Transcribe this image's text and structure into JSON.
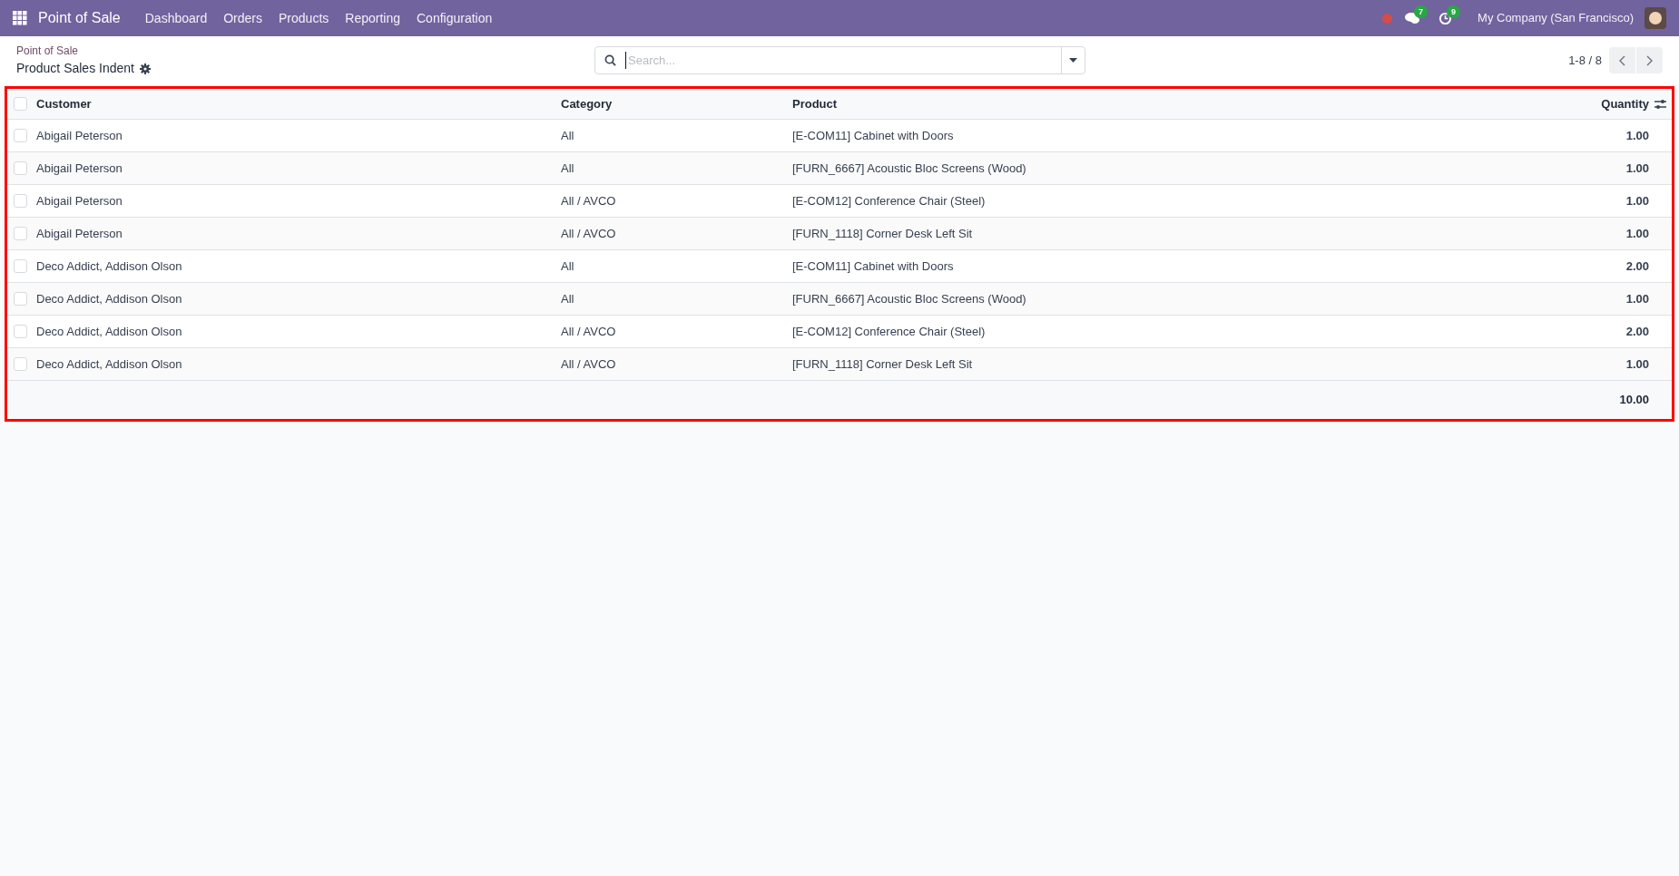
{
  "navbar": {
    "app_name": "Point of Sale",
    "menu": [
      "Dashboard",
      "Orders",
      "Products",
      "Reporting",
      "Configuration"
    ],
    "messages_count": "7",
    "activities_count": "9",
    "company": "My Company (San Francisco)"
  },
  "control_panel": {
    "breadcrumb": "Point of Sale",
    "title": "Product Sales Indent",
    "search": {
      "placeholder": "Search..."
    },
    "pager": "1-8 / 8"
  },
  "table": {
    "all_selected": false,
    "columns": [
      "Customer",
      "Category",
      "Product",
      "Quantity"
    ],
    "rows": [
      {
        "selected": false,
        "cells": [
          "Abigail Peterson",
          "All",
          "[E-COM11] Cabinet with Doors",
          "1.00"
        ]
      },
      {
        "selected": false,
        "cells": [
          "Abigail Peterson",
          "All",
          "[FURN_6667] Acoustic Bloc Screens (Wood)",
          "1.00"
        ]
      },
      {
        "selected": false,
        "cells": [
          "Abigail Peterson",
          "All / AVCO",
          "[E-COM12] Conference Chair (Steel)",
          "1.00"
        ]
      },
      {
        "selected": false,
        "cells": [
          "Abigail Peterson",
          "All / AVCO",
          "[FURN_1118] Corner Desk Left Sit",
          "1.00"
        ]
      },
      {
        "selected": false,
        "cells": [
          "Deco Addict, Addison Olson",
          "All",
          "[E-COM11] Cabinet with Doors",
          "2.00"
        ]
      },
      {
        "selected": false,
        "cells": [
          "Deco Addict, Addison Olson",
          "All",
          "[FURN_6667] Acoustic Bloc Screens (Wood)",
          "1.00"
        ]
      },
      {
        "selected": false,
        "cells": [
          "Deco Addict, Addison Olson",
          "All / AVCO",
          "[E-COM12] Conference Chair (Steel)",
          "2.00"
        ]
      },
      {
        "selected": false,
        "cells": [
          "Deco Addict, Addison Olson",
          "All / AVCO",
          "[FURN_1118] Corner Desk Left Sit",
          "1.00"
        ]
      }
    ],
    "total": "10.00"
  }
}
